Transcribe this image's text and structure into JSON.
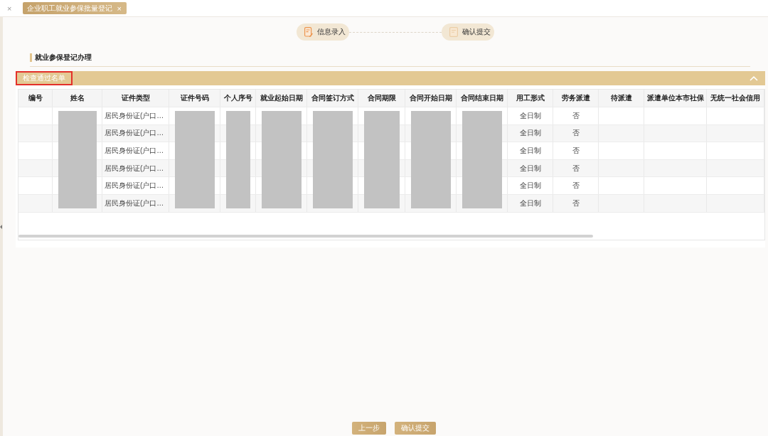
{
  "tabs": [
    {
      "close": "×",
      "selected": false
    },
    {
      "label": "企业职工就业参保批量登记",
      "close": "×",
      "selected": true
    }
  ],
  "steps": [
    {
      "label": "信息录入",
      "selected": true
    },
    {
      "label": "确认提交",
      "selected": false
    }
  ],
  "section": {
    "title": "就业参保登记办理"
  },
  "panel": {
    "title": "检查通过名单",
    "highlighted": true,
    "expanded": true
  },
  "table": {
    "columns": [
      {
        "label": "编号",
        "redacted": false
      },
      {
        "label": "姓名",
        "redacted": true
      },
      {
        "label": "证件类型",
        "redacted": false
      },
      {
        "label": "证件号码",
        "redacted": true
      },
      {
        "label": "个人序号",
        "redacted": true
      },
      {
        "label": "就业起始日期",
        "redacted": true
      },
      {
        "label": "合同签订方式",
        "redacted": true
      },
      {
        "label": "合同期限",
        "redacted": true
      },
      {
        "label": "合同开始日期",
        "redacted": true
      },
      {
        "label": "合同结束日期",
        "redacted": true
      },
      {
        "label": "用工形式",
        "redacted": false
      },
      {
        "label": "劳务派遣",
        "redacted": false
      },
      {
        "label": "待派遣",
        "redacted": false
      },
      {
        "label": "派遣单位本市社保",
        "redacted": false
      },
      {
        "label": "无统一社会信用",
        "redacted": false
      }
    ],
    "rows": [
      {
        "id_type": "居民身份证(户口…",
        "employment_form": "全日制",
        "labor_dispatch": "否"
      },
      {
        "id_type": "居民身份证(户口…",
        "employment_form": "全日制",
        "labor_dispatch": "否"
      },
      {
        "id_type": "居民身份证(户口…",
        "employment_form": "全日制",
        "labor_dispatch": "否"
      },
      {
        "id_type": "居民身份证(户口…",
        "employment_form": "全日制",
        "labor_dispatch": "否"
      },
      {
        "id_type": "居民身份证(户口…",
        "employment_form": "全日制",
        "labor_dispatch": "否"
      },
      {
        "id_type": "居民身份证(户口…",
        "employment_form": "全日制",
        "labor_dispatch": "否"
      }
    ]
  },
  "buttons": [
    {
      "label": "上一步"
    },
    {
      "label": "确认提交"
    }
  ]
}
